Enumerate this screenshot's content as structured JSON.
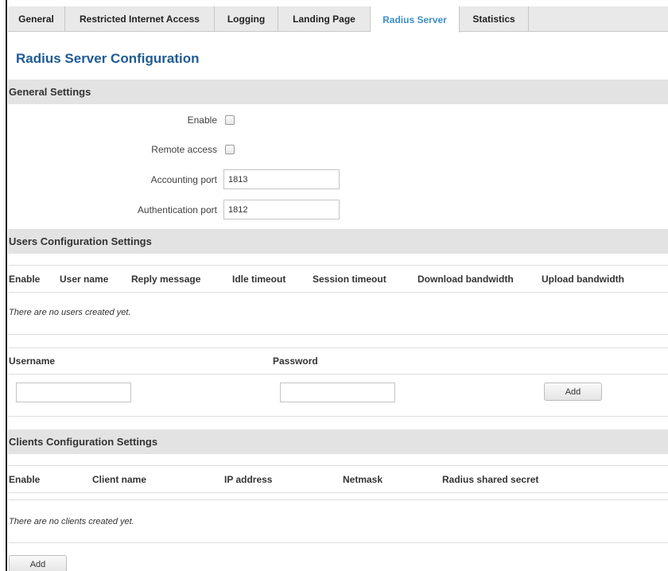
{
  "tabs": [
    {
      "label": "General"
    },
    {
      "label": "Restricted Internet Access"
    },
    {
      "label": "Logging"
    },
    {
      "label": "Landing Page"
    },
    {
      "label": "Radius Server",
      "active": true
    },
    {
      "label": "Statistics"
    }
  ],
  "page_title": "Radius Server Configuration",
  "general": {
    "heading": "General Settings",
    "enable_label": "Enable",
    "enable_checked": false,
    "remote_label": "Remote access",
    "remote_checked": false,
    "acct_port_label": "Accounting port",
    "acct_port_value": "1813",
    "auth_port_label": "Authentication port",
    "auth_port_value": "1812"
  },
  "users": {
    "heading": "Users Configuration Settings",
    "columns": [
      "Enable",
      "User name",
      "Reply message",
      "Idle timeout",
      "Session timeout",
      "Download bandwidth",
      "Upload bandwidth"
    ],
    "empty_message": "There are no users created yet.",
    "username_label": "Username",
    "password_label": "Password",
    "username_value": "",
    "password_value": "",
    "add_label": "Add"
  },
  "clients": {
    "heading": "Clients Configuration Settings",
    "columns": [
      "Enable",
      "Client name",
      "IP address",
      "Netmask",
      "Radius shared secret"
    ],
    "empty_message": "There are no clients created yet.",
    "add_label": "Add"
  },
  "colors": {
    "accent": "#3d8ec9",
    "title": "#1f5b93",
    "section_bg": "#e3e3e3",
    "tab_bg": "#e9e9e9"
  }
}
